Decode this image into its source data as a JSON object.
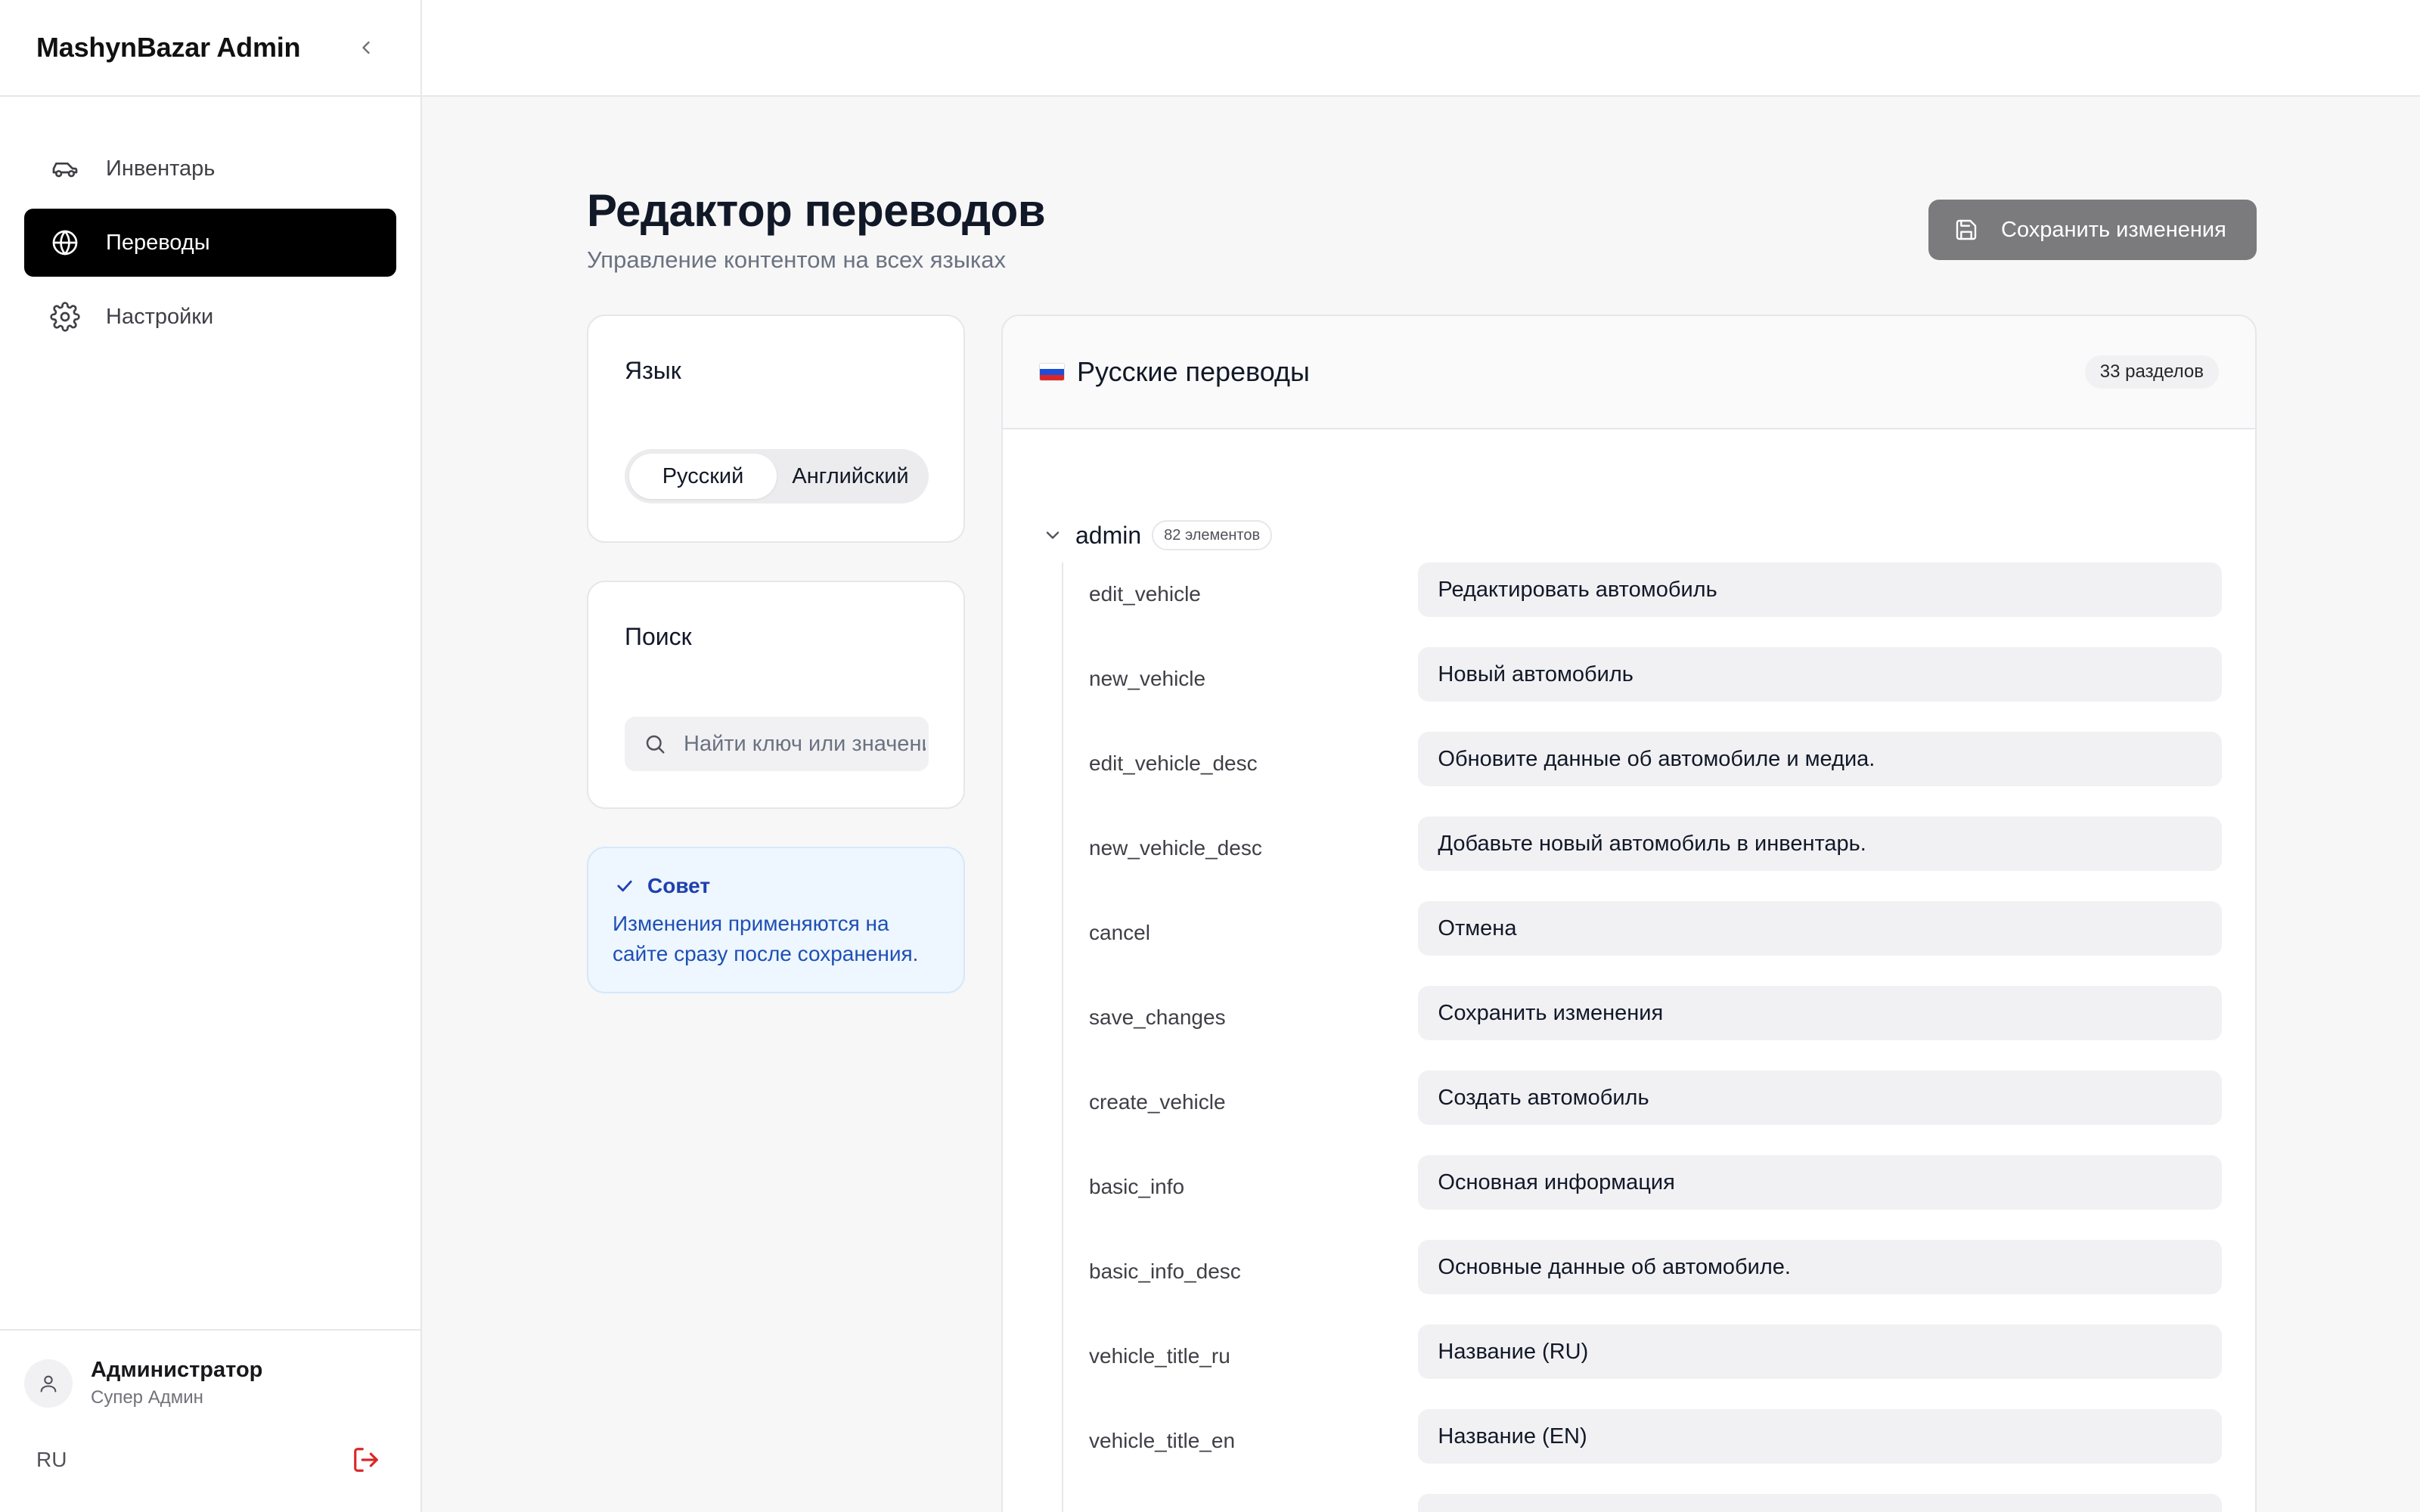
{
  "app": {
    "title": "MashynBazar Admin"
  },
  "sidebar": {
    "items": [
      {
        "label": "Инвентарь",
        "icon": "car-icon"
      },
      {
        "label": "Переводы",
        "icon": "globe-icon"
      },
      {
        "label": "Настройки",
        "icon": "gear-icon"
      }
    ],
    "active_index": 1,
    "user": {
      "name": "Администратор",
      "role": "Супер Админ"
    },
    "language_code": "RU"
  },
  "page": {
    "title": "Редактор переводов",
    "subtitle": "Управление контентом на всех языках",
    "save_label": "Сохранить изменения"
  },
  "language_card": {
    "title": "Язык",
    "options": [
      "Русский",
      "Английский"
    ],
    "selected": "Русский"
  },
  "search_card": {
    "title": "Поиск",
    "placeholder": "Найти ключ или значение"
  },
  "tip": {
    "title": "Совет",
    "text": "Изменения применяются на сайте сразу после сохранения."
  },
  "panel": {
    "title": "Русские переводы",
    "sections_count": "33 разделов",
    "section": {
      "name": "admin",
      "badge": "82 элементов",
      "rows": [
        {
          "key": "edit_vehicle",
          "value": "Редактировать автомобиль"
        },
        {
          "key": "new_vehicle",
          "value": "Новый автомобиль"
        },
        {
          "key": "edit_vehicle_desc",
          "value": "Обновите данные об автомобиле и медиа."
        },
        {
          "key": "new_vehicle_desc",
          "value": "Добавьте новый автомобиль в инвентарь."
        },
        {
          "key": "cancel",
          "value": "Отмена"
        },
        {
          "key": "save_changes",
          "value": "Сохранить изменения"
        },
        {
          "key": "create_vehicle",
          "value": "Создать автомобиль"
        },
        {
          "key": "basic_info",
          "value": "Основная информация"
        },
        {
          "key": "basic_info_desc",
          "value": "Основные данные об автомобиле."
        },
        {
          "key": "vehicle_title_ru",
          "value": "Название (RU)"
        },
        {
          "key": "vehicle_title_en",
          "value": "Название (EN)"
        },
        {
          "key": "",
          "value": ""
        }
      ]
    }
  },
  "colors": {
    "accent": "#000000",
    "save_button": "#7b7b7e",
    "tip_bg": "#eef6ff",
    "tip_text": "#1e4fb4",
    "logout": "#dc2626"
  }
}
